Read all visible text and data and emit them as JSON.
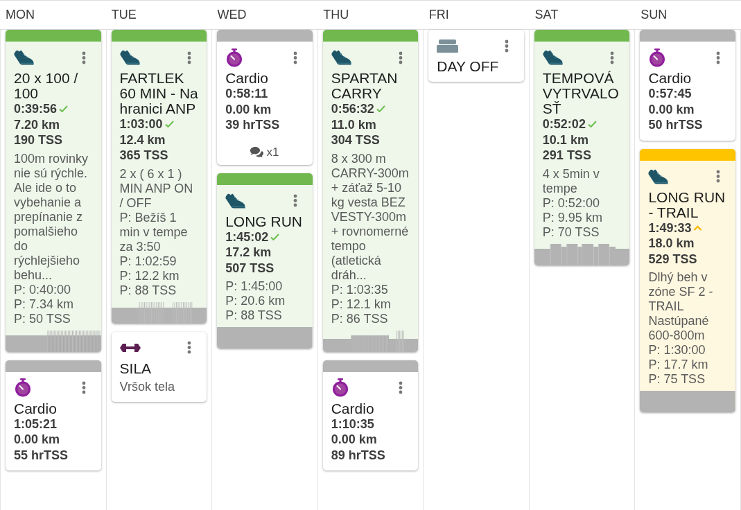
{
  "days": [
    {
      "label": "MON",
      "workouts": [
        {
          "kind": "run",
          "color": "#71b94f",
          "title": "20 x 100 / 100",
          "duration": "0:39:56",
          "goal_met": true,
          "distance": "7.20 km",
          "load": "190 TSS",
          "description": "100m rovinky nie sú rýchle. Ale ide o to vybehanie a prepínanie z pomalšieho do rýchlejšieho behu...",
          "planned": [
            "P: 0:40:00",
            "P: 7.34 km",
            "P: 50 TSS"
          ],
          "graph": true
        },
        {
          "kind": "cardio",
          "color": "#b4b4b4",
          "title": "Cardio",
          "duration": "1:05:21",
          "distance": "0.00 km",
          "load": "55 hrTSS"
        }
      ]
    },
    {
      "label": "TUE",
      "workouts": [
        {
          "kind": "run",
          "color": "#71b94f",
          "title": "FARTLEK 60 MIN - Na hranici ANP",
          "duration": "1:03:00",
          "goal_met": true,
          "distance": "12.4 km",
          "load": "365 TSS",
          "description": "2 x ( 6 x 1 ) MIN ANP ON / OFF\nP: Bežíš 1 min v tempe za 3:50",
          "planned": [
            "P: 1:02:59",
            "P: 12.2 km",
            "P: 88 TSS"
          ],
          "graph": true
        },
        {
          "kind": "strength",
          "title": "SILA",
          "description": "Vršok tela"
        }
      ]
    },
    {
      "label": "WED",
      "workouts": [
        {
          "kind": "cardio",
          "color": "#b4b4b4",
          "title": "Cardio",
          "duration": "0:58:11",
          "distance": "0.00 km",
          "load": "39 hrTSS",
          "comments": "x1"
        },
        {
          "kind": "run",
          "color": "#71b94f",
          "title": "LONG RUN",
          "duration": "1:45:02",
          "goal_met": true,
          "distance": "17.2 km",
          "load": "507 TSS",
          "planned": [
            "P: 1:45:00",
            "P: 20.6 km",
            "P: 88 TSS"
          ],
          "graph": true
        }
      ]
    },
    {
      "label": "THU",
      "workouts": [
        {
          "kind": "run",
          "color": "#71b94f",
          "title": "SPARTAN CARRY",
          "duration": "0:56:32",
          "goal_met": true,
          "distance": "11.0 km",
          "load": "304 TSS",
          "description": "8 x 300 m CARRY-300m + záťaž 5-10 kg vesta BEZ VESTY-300m + rovnomerné tempo (atletická dráh...",
          "planned": [
            "P: 1:03:35",
            "P: 12.1 km",
            "P: 86 TSS"
          ],
          "graph": true
        },
        {
          "kind": "cardio",
          "color": "#b4b4b4",
          "title": "Cardio",
          "duration": "1:10:35",
          "distance": "0.00 km",
          "load": "89 hrTSS"
        }
      ]
    },
    {
      "label": "FRI",
      "workouts": [
        {
          "kind": "day_off",
          "title": "DAY OFF"
        }
      ]
    },
    {
      "label": "SAT",
      "workouts": [
        {
          "kind": "run",
          "color": "#71b94f",
          "title": "TEMPOVÁ VYTRVALOSŤ",
          "duration": "0:52:02",
          "goal_met": true,
          "distance": "10.1 km",
          "load": "291 TSS",
          "description": "4 x 5min v tempe",
          "planned": [
            "P: 0:52:00",
            "P: 9.95 km",
            "P: 70 TSS"
          ],
          "graph": true
        }
      ]
    },
    {
      "label": "SUN",
      "workouts": [
        {
          "kind": "cardio",
          "color": "#b4b4b4",
          "title": "Cardio",
          "duration": "0:57:45",
          "distance": "0.00 km",
          "load": "50 hrTSS"
        },
        {
          "kind": "run",
          "color": "#fec400",
          "title": "LONG RUN - TRAIL",
          "duration": "1:49:33",
          "goal_met": false,
          "distance": "18.0 km",
          "load": "529 TSS",
          "description": "Dlhý beh v zóne SF 2 - TRAIL Nastúpané 600-800m",
          "planned": [
            "P: 1:30:00",
            "P: 17.7 km",
            "P: 75 TSS"
          ],
          "graph": true
        }
      ]
    }
  ]
}
